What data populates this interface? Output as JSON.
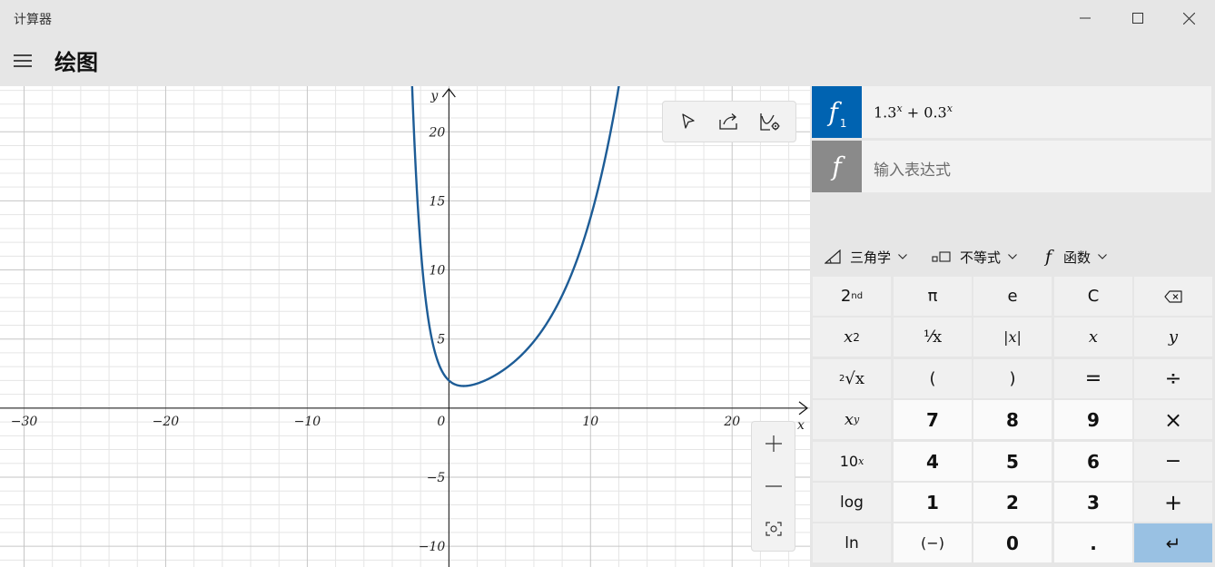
{
  "window": {
    "title": "计算器"
  },
  "header": {
    "title": "绘图"
  },
  "graph": {
    "x_tick_labels": [
      "−30",
      "−20",
      "−10",
      "0",
      "10",
      "20"
    ],
    "y_tick_labels": [
      "20",
      "15",
      "10",
      "5",
      "−5",
      "−10"
    ],
    "x_axis_label": "x",
    "y_axis_label": "y",
    "curve_color": "#1d5c96",
    "xlim": [
      -31.7,
      25.5
    ],
    "ylim": [
      -11.5,
      23.3
    ]
  },
  "chart_data": {
    "type": "line",
    "series": [
      {
        "expression": "1.3^x + 0.3^x"
      }
    ],
    "x_ticks": [
      -30,
      -20,
      -10,
      0,
      10,
      20
    ],
    "y_ticks": [
      20,
      15,
      10,
      5,
      -5,
      -10
    ],
    "grid": true
  },
  "functions": {
    "f1": {
      "symbol": "f",
      "index": "1",
      "color": "#0063b1"
    },
    "f2": {
      "symbol": "f",
      "placeholder": "输入表达式",
      "color": "#8a8a8a"
    }
  },
  "categories": {
    "trig": "三角学",
    "inequality": "不等式",
    "function_symbol": "f",
    "function": "函数"
  },
  "keys": {
    "second": "2",
    "second_sup": "nd",
    "pi": "π",
    "e": "e",
    "clear": "C",
    "x2_base": "x",
    "x2_sup": "2",
    "reciprocal": "¹⁄x",
    "abs": "|x|",
    "x": "x",
    "y": "y",
    "sqrt_idx": "2",
    "sqrt_rad": "√x",
    "lparen": "(",
    "rparen": ")",
    "equals": "=",
    "divide": "÷",
    "xy_base": "x",
    "xy_sup": "y",
    "seven": "7",
    "eight": "8",
    "nine": "9",
    "times": "×",
    "ten_base": "10",
    "ten_sup": "x",
    "four": "4",
    "five": "5",
    "six": "6",
    "minus": "−",
    "log": "log",
    "one": "1",
    "two": "2",
    "three": "3",
    "plus": "+",
    "ln": "ln",
    "negate": "(−)",
    "zero": "0",
    "dot": ".",
    "enter": "↵"
  },
  "icons": {
    "minimize": "minimize-icon",
    "maximize": "maximize-icon",
    "close": "close-icon",
    "menu": "hamburger-icon",
    "select": "cursor-icon",
    "share": "share-icon",
    "graph_settings": "graph-settings-icon",
    "zoom_in": "zoom-in-icon",
    "zoom_out": "zoom-out-icon",
    "reset_view": "fit-view-icon",
    "backspace": "backspace-icon"
  }
}
